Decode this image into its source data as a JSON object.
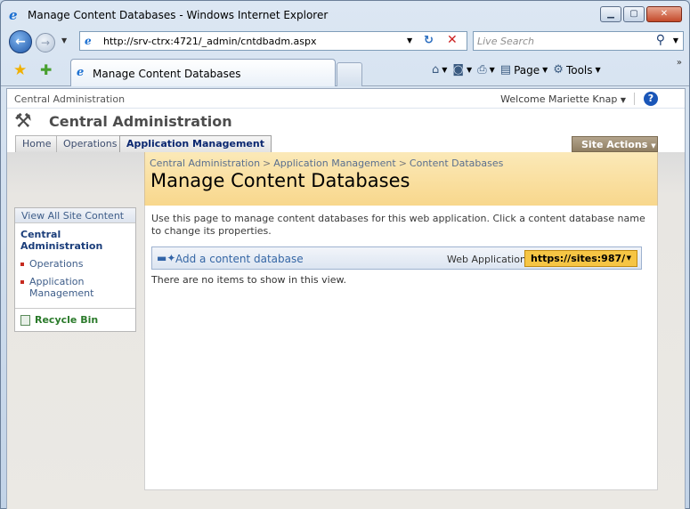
{
  "window": {
    "title": "Manage Content Databases - Windows Internet Explorer"
  },
  "address": {
    "url": "http://srv-ctrx:4721/_admin/cntdbadm.aspx",
    "search_placeholder": "Live Search"
  },
  "tab": {
    "label": "Manage Content Databases"
  },
  "commands": {
    "page_label": "Page",
    "tools_label": "Tools"
  },
  "sp_topbar": {
    "site_name": "Central Administration",
    "welcome": "Welcome Mariette Knap",
    "help_icon": "?"
  },
  "site": {
    "title": "Central Administration"
  },
  "global_tabs": {
    "items": [
      "Home",
      "Operations",
      "Application Management"
    ],
    "active": "Application Management",
    "site_actions": "Site Actions"
  },
  "breadcrumb": {
    "items": [
      "Central Administration",
      "Application Management",
      "Content Databases"
    ],
    "separator": ">"
  },
  "page": {
    "title": "Manage Content Databases",
    "description": "Use this page to manage content databases for this web application. Click a content database name to change its properties.",
    "add_link": "Add a content database",
    "web_app_label": "Web Application:",
    "web_app_value": "https://sites:987/",
    "empty_message": "There are no items to show in this view."
  },
  "quick_launch": {
    "view_all": "View All Site Content",
    "heading": "Central Administration",
    "items": [
      "Operations",
      "Application Management"
    ],
    "recycle_bin": "Recycle Bin"
  }
}
